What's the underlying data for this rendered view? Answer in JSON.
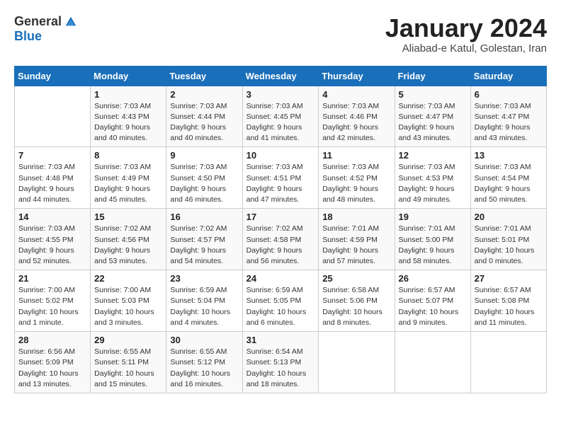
{
  "logo": {
    "general": "General",
    "blue": "Blue"
  },
  "title": "January 2024",
  "subtitle": "Aliabad-e Katul, Golestan, Iran",
  "weekdays": [
    "Sunday",
    "Monday",
    "Tuesday",
    "Wednesday",
    "Thursday",
    "Friday",
    "Saturday"
  ],
  "weeks": [
    [
      {
        "day": "",
        "info": ""
      },
      {
        "day": "1",
        "info": "Sunrise: 7:03 AM\nSunset: 4:43 PM\nDaylight: 9 hours\nand 40 minutes."
      },
      {
        "day": "2",
        "info": "Sunrise: 7:03 AM\nSunset: 4:44 PM\nDaylight: 9 hours\nand 40 minutes."
      },
      {
        "day": "3",
        "info": "Sunrise: 7:03 AM\nSunset: 4:45 PM\nDaylight: 9 hours\nand 41 minutes."
      },
      {
        "day": "4",
        "info": "Sunrise: 7:03 AM\nSunset: 4:46 PM\nDaylight: 9 hours\nand 42 minutes."
      },
      {
        "day": "5",
        "info": "Sunrise: 7:03 AM\nSunset: 4:47 PM\nDaylight: 9 hours\nand 43 minutes."
      },
      {
        "day": "6",
        "info": "Sunrise: 7:03 AM\nSunset: 4:47 PM\nDaylight: 9 hours\nand 43 minutes."
      }
    ],
    [
      {
        "day": "7",
        "info": "Sunrise: 7:03 AM\nSunset: 4:48 PM\nDaylight: 9 hours\nand 44 minutes."
      },
      {
        "day": "8",
        "info": "Sunrise: 7:03 AM\nSunset: 4:49 PM\nDaylight: 9 hours\nand 45 minutes."
      },
      {
        "day": "9",
        "info": "Sunrise: 7:03 AM\nSunset: 4:50 PM\nDaylight: 9 hours\nand 46 minutes."
      },
      {
        "day": "10",
        "info": "Sunrise: 7:03 AM\nSunset: 4:51 PM\nDaylight: 9 hours\nand 47 minutes."
      },
      {
        "day": "11",
        "info": "Sunrise: 7:03 AM\nSunset: 4:52 PM\nDaylight: 9 hours\nand 48 minutes."
      },
      {
        "day": "12",
        "info": "Sunrise: 7:03 AM\nSunset: 4:53 PM\nDaylight: 9 hours\nand 49 minutes."
      },
      {
        "day": "13",
        "info": "Sunrise: 7:03 AM\nSunset: 4:54 PM\nDaylight: 9 hours\nand 50 minutes."
      }
    ],
    [
      {
        "day": "14",
        "info": "Sunrise: 7:03 AM\nSunset: 4:55 PM\nDaylight: 9 hours\nand 52 minutes."
      },
      {
        "day": "15",
        "info": "Sunrise: 7:02 AM\nSunset: 4:56 PM\nDaylight: 9 hours\nand 53 minutes."
      },
      {
        "day": "16",
        "info": "Sunrise: 7:02 AM\nSunset: 4:57 PM\nDaylight: 9 hours\nand 54 minutes."
      },
      {
        "day": "17",
        "info": "Sunrise: 7:02 AM\nSunset: 4:58 PM\nDaylight: 9 hours\nand 56 minutes."
      },
      {
        "day": "18",
        "info": "Sunrise: 7:01 AM\nSunset: 4:59 PM\nDaylight: 9 hours\nand 57 minutes."
      },
      {
        "day": "19",
        "info": "Sunrise: 7:01 AM\nSunset: 5:00 PM\nDaylight: 9 hours\nand 58 minutes."
      },
      {
        "day": "20",
        "info": "Sunrise: 7:01 AM\nSunset: 5:01 PM\nDaylight: 10 hours\nand 0 minutes."
      }
    ],
    [
      {
        "day": "21",
        "info": "Sunrise: 7:00 AM\nSunset: 5:02 PM\nDaylight: 10 hours\nand 1 minute."
      },
      {
        "day": "22",
        "info": "Sunrise: 7:00 AM\nSunset: 5:03 PM\nDaylight: 10 hours\nand 3 minutes."
      },
      {
        "day": "23",
        "info": "Sunrise: 6:59 AM\nSunset: 5:04 PM\nDaylight: 10 hours\nand 4 minutes."
      },
      {
        "day": "24",
        "info": "Sunrise: 6:59 AM\nSunset: 5:05 PM\nDaylight: 10 hours\nand 6 minutes."
      },
      {
        "day": "25",
        "info": "Sunrise: 6:58 AM\nSunset: 5:06 PM\nDaylight: 10 hours\nand 8 minutes."
      },
      {
        "day": "26",
        "info": "Sunrise: 6:57 AM\nSunset: 5:07 PM\nDaylight: 10 hours\nand 9 minutes."
      },
      {
        "day": "27",
        "info": "Sunrise: 6:57 AM\nSunset: 5:08 PM\nDaylight: 10 hours\nand 11 minutes."
      }
    ],
    [
      {
        "day": "28",
        "info": "Sunrise: 6:56 AM\nSunset: 5:09 PM\nDaylight: 10 hours\nand 13 minutes."
      },
      {
        "day": "29",
        "info": "Sunrise: 6:55 AM\nSunset: 5:11 PM\nDaylight: 10 hours\nand 15 minutes."
      },
      {
        "day": "30",
        "info": "Sunrise: 6:55 AM\nSunset: 5:12 PM\nDaylight: 10 hours\nand 16 minutes."
      },
      {
        "day": "31",
        "info": "Sunrise: 6:54 AM\nSunset: 5:13 PM\nDaylight: 10 hours\nand 18 minutes."
      },
      {
        "day": "",
        "info": ""
      },
      {
        "day": "",
        "info": ""
      },
      {
        "day": "",
        "info": ""
      }
    ]
  ]
}
